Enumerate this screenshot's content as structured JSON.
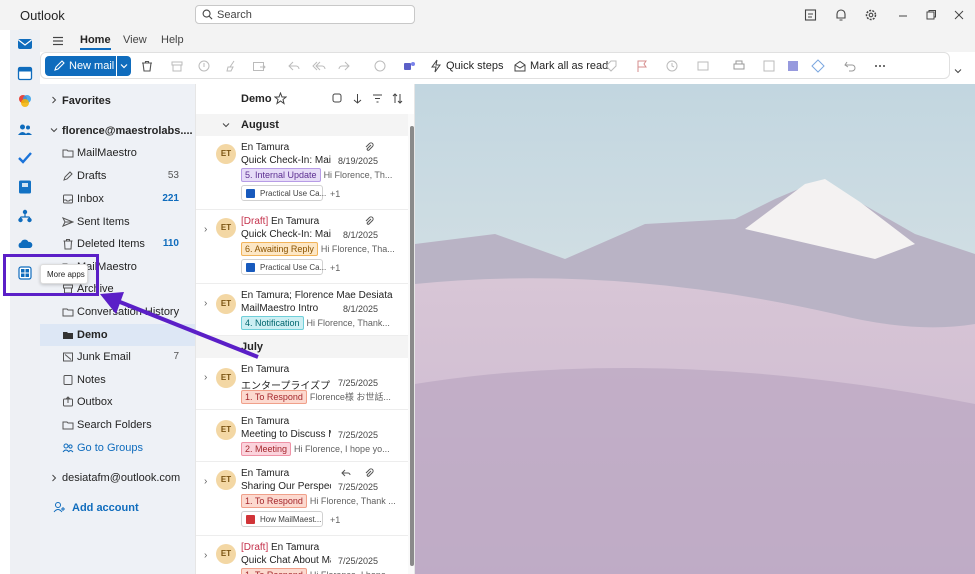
{
  "app": {
    "title": "Outlook",
    "search_placeholder": "Search"
  },
  "ribbon_tabs": [
    "Home",
    "View",
    "Help"
  ],
  "ribbon": {
    "new_mail": "New mail",
    "quick_steps": "Quick steps",
    "mark_all_read": "Mark all as read"
  },
  "nav": {
    "favorites": "Favorites",
    "account1": "florence@maestrolabs....",
    "account2": "desiatafm@outlook.com",
    "add_account": "Add account"
  },
  "folders": [
    {
      "label": "MailMaestro",
      "count": ""
    },
    {
      "label": "Drafts",
      "count": "53"
    },
    {
      "label": "Inbox",
      "count": "221"
    },
    {
      "label": "Sent Items",
      "count": ""
    },
    {
      "label": "Deleted Items",
      "count": "110"
    },
    {
      "label": "MailMaestro",
      "count": ""
    },
    {
      "label": "Archive",
      "count": ""
    },
    {
      "label": "Conversation History",
      "count": ""
    },
    {
      "label": "Demo",
      "count": ""
    },
    {
      "label": "Junk Email",
      "count": "7"
    },
    {
      "label": "Notes",
      "count": ""
    },
    {
      "label": "Outbox",
      "count": ""
    },
    {
      "label": "Search Folders",
      "count": ""
    },
    {
      "label": "Go to Groups",
      "count": ""
    }
  ],
  "message_list": {
    "folder": "Demo",
    "groups": [
      "August",
      "July"
    ],
    "messages": [
      {
        "avatar": "ET",
        "draft": "",
        "sender": "En Tamura",
        "subject": "Quick Check-In: Mail...",
        "date": "8/19/2025",
        "tag": "5. Internal Update",
        "tag_bg": "#e6dcf7",
        "tag_fg": "#5c2e91",
        "tag_bd": "#b79ce6",
        "preview": "Hi Florence, Th...",
        "attachment": "Practical Use Ca...",
        "more": "+1"
      },
      {
        "avatar": "ET",
        "draft": "[Draft]",
        "sender": "En Tamura",
        "subject": "Quick Check-In: MailM...",
        "date": "8/1/2025",
        "tag": "6. Awaiting Reply",
        "tag_bg": "#fde7c5",
        "tag_fg": "#8a5300",
        "tag_bd": "#f2b45a",
        "preview": "Hi Florence, Tha...",
        "attachment": "Practical Use Ca...",
        "more": "+1"
      },
      {
        "avatar": "ET",
        "draft": "",
        "sender": "En Tamura; Florence Mae Desiata",
        "subject": "MailMaestro Intro",
        "date": "8/1/2025",
        "tag": "4. Notification",
        "tag_bg": "#cdeff3",
        "tag_fg": "#00666e",
        "tag_bd": "#6fcfd9",
        "preview": "Hi Florence, Thank...",
        "attachment": "",
        "more": ""
      },
      {
        "avatar": "ET",
        "draft": "",
        "sender": "En Tamura",
        "subject": "エンタープライズプ...",
        "date": "7/25/2025",
        "tag": "1. To Respond",
        "tag_bg": "#fcd9cf",
        "tag_fg": "#a4262c",
        "tag_bd": "#f0a08a",
        "preview": "Florence様 お世話...",
        "attachment": "",
        "more": ""
      },
      {
        "avatar": "ET",
        "draft": "",
        "sender": "En Tamura",
        "subject": "Meeting to Discuss M...",
        "date": "7/25/2025",
        "tag": "2. Meeting",
        "tag_bg": "#fbd3dc",
        "tag_fg": "#a4262c",
        "tag_bd": "#ef92a6",
        "preview": "Hi Florence, I hope yo...",
        "attachment": "",
        "more": ""
      },
      {
        "avatar": "ET",
        "draft": "",
        "sender": "En Tamura",
        "subject": "Sharing Our Perspecti...",
        "date": "7/25/2025",
        "tag": "1. To Respond",
        "tag_bg": "#fcd9cf",
        "tag_fg": "#a4262c",
        "tag_bd": "#f0a08a",
        "preview": "Hi Florence, Thank ...",
        "attachment": "How MailMaest...",
        "more": "+1"
      },
      {
        "avatar": "ET",
        "draft": "[Draft]",
        "sender": "En Tamura",
        "subject": "Quick Chat About Ma...",
        "date": "7/25/2025",
        "tag": "1. To Respond",
        "tag_bg": "#fcd9cf",
        "tag_fg": "#a4262c",
        "tag_bd": "#f0a08a",
        "preview": "Hi Florence, I hope...",
        "attachment": "",
        "more": ""
      }
    ]
  },
  "tooltip": "More apps",
  "colors": {
    "accent": "#0f6cbd",
    "highlight": "#5b1fc7"
  }
}
